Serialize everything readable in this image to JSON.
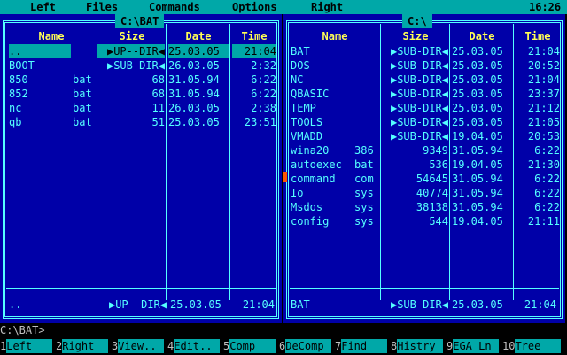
{
  "menubar": {
    "items": [
      "Left",
      "Files",
      "Commands",
      "Options",
      "Right"
    ],
    "clock": "16:26"
  },
  "left_panel": {
    "title": "C:\\BAT",
    "headers": {
      "name": "Name",
      "size": "Size",
      "date": "Date",
      "time": "Time"
    },
    "files": [
      {
        "name": "..",
        "ext": "",
        "size": "▶UP--DIR◀",
        "date": "25.03.05",
        "time": "21:04",
        "selected": true
      },
      {
        "name": "BOOT",
        "ext": "",
        "size": "▶SUB-DIR◀",
        "date": "26.03.05",
        "time": "2:32"
      },
      {
        "name": "850",
        "ext": "bat",
        "size": "68",
        "date": "31.05.94",
        "time": "6:22"
      },
      {
        "name": "852",
        "ext": "bat",
        "size": "68",
        "date": "31.05.94",
        "time": "6:22"
      },
      {
        "name": "nc",
        "ext": "bat",
        "size": "11",
        "date": "26.03.05",
        "time": "2:38"
      },
      {
        "name": "qb",
        "ext": "bat",
        "size": "51",
        "date": "25.03.05",
        "time": "23:51"
      }
    ],
    "status": {
      "name": "..",
      "size": "▶UP--DIR◀",
      "date": "25.03.05",
      "time": "21:04"
    }
  },
  "right_panel": {
    "title": "C:\\",
    "headers": {
      "name": "Name",
      "size": "Size",
      "date": "Date",
      "time": "Time"
    },
    "files": [
      {
        "name": "BAT",
        "ext": "",
        "size": "▶SUB-DIR◀",
        "date": "25.03.05",
        "time": "21:04"
      },
      {
        "name": "DOS",
        "ext": "",
        "size": "▶SUB-DIR◀",
        "date": "25.03.05",
        "time": "20:52"
      },
      {
        "name": "NC",
        "ext": "",
        "size": "▶SUB-DIR◀",
        "date": "25.03.05",
        "time": "21:04"
      },
      {
        "name": "QBASIC",
        "ext": "",
        "size": "▶SUB-DIR◀",
        "date": "25.03.05",
        "time": "23:37"
      },
      {
        "name": "TEMP",
        "ext": "",
        "size": "▶SUB-DIR◀",
        "date": "25.03.05",
        "time": "21:12"
      },
      {
        "name": "TOOLS",
        "ext": "",
        "size": "▶SUB-DIR◀",
        "date": "25.03.05",
        "time": "21:05"
      },
      {
        "name": "VMADD",
        "ext": "",
        "size": "▶SUB-DIR◀",
        "date": "19.04.05",
        "time": "20:53"
      },
      {
        "name": "wina20",
        "ext": "386",
        "size": "9349",
        "date": "31.05.94",
        "time": "6:22"
      },
      {
        "name": "autoexec",
        "ext": "bat",
        "size": "536",
        "date": "19.04.05",
        "time": "21:30"
      },
      {
        "name": "command",
        "ext": "com",
        "size": "54645",
        "date": "31.05.94",
        "time": "6:22"
      },
      {
        "name": "Io",
        "ext": "sys",
        "size": "40774",
        "date": "31.05.94",
        "time": "6:22"
      },
      {
        "name": "Msdos",
        "ext": "sys",
        "size": "38138",
        "date": "31.05.94",
        "time": "6:22"
      },
      {
        "name": "config",
        "ext": "sys",
        "size": "544",
        "date": "19.04.05",
        "time": "21:11"
      }
    ],
    "status": {
      "name": "BAT",
      "size": "▶SUB-DIR◀",
      "date": "25.03.05",
      "time": "21:04"
    }
  },
  "command_line": {
    "prompt": "C:\\BAT>"
  },
  "function_keys": [
    {
      "num": "1",
      "label": "Left"
    },
    {
      "num": "2",
      "label": "Right"
    },
    {
      "num": "3",
      "label": "View.."
    },
    {
      "num": "4",
      "label": "Edit.."
    },
    {
      "num": "5",
      "label": "Comp"
    },
    {
      "num": "6",
      "label": "DeComp"
    },
    {
      "num": "7",
      "label": "Find"
    },
    {
      "num": "8",
      "label": "Histry"
    },
    {
      "num": "9",
      "label": "EGA Ln"
    },
    {
      "num": "10",
      "label": "Tree"
    }
  ],
  "colors": {
    "panel": "#0000a8",
    "text": "#55ffff",
    "header": "#ffff55",
    "bar": "#00a8a8",
    "cursor": "#ff5500"
  }
}
